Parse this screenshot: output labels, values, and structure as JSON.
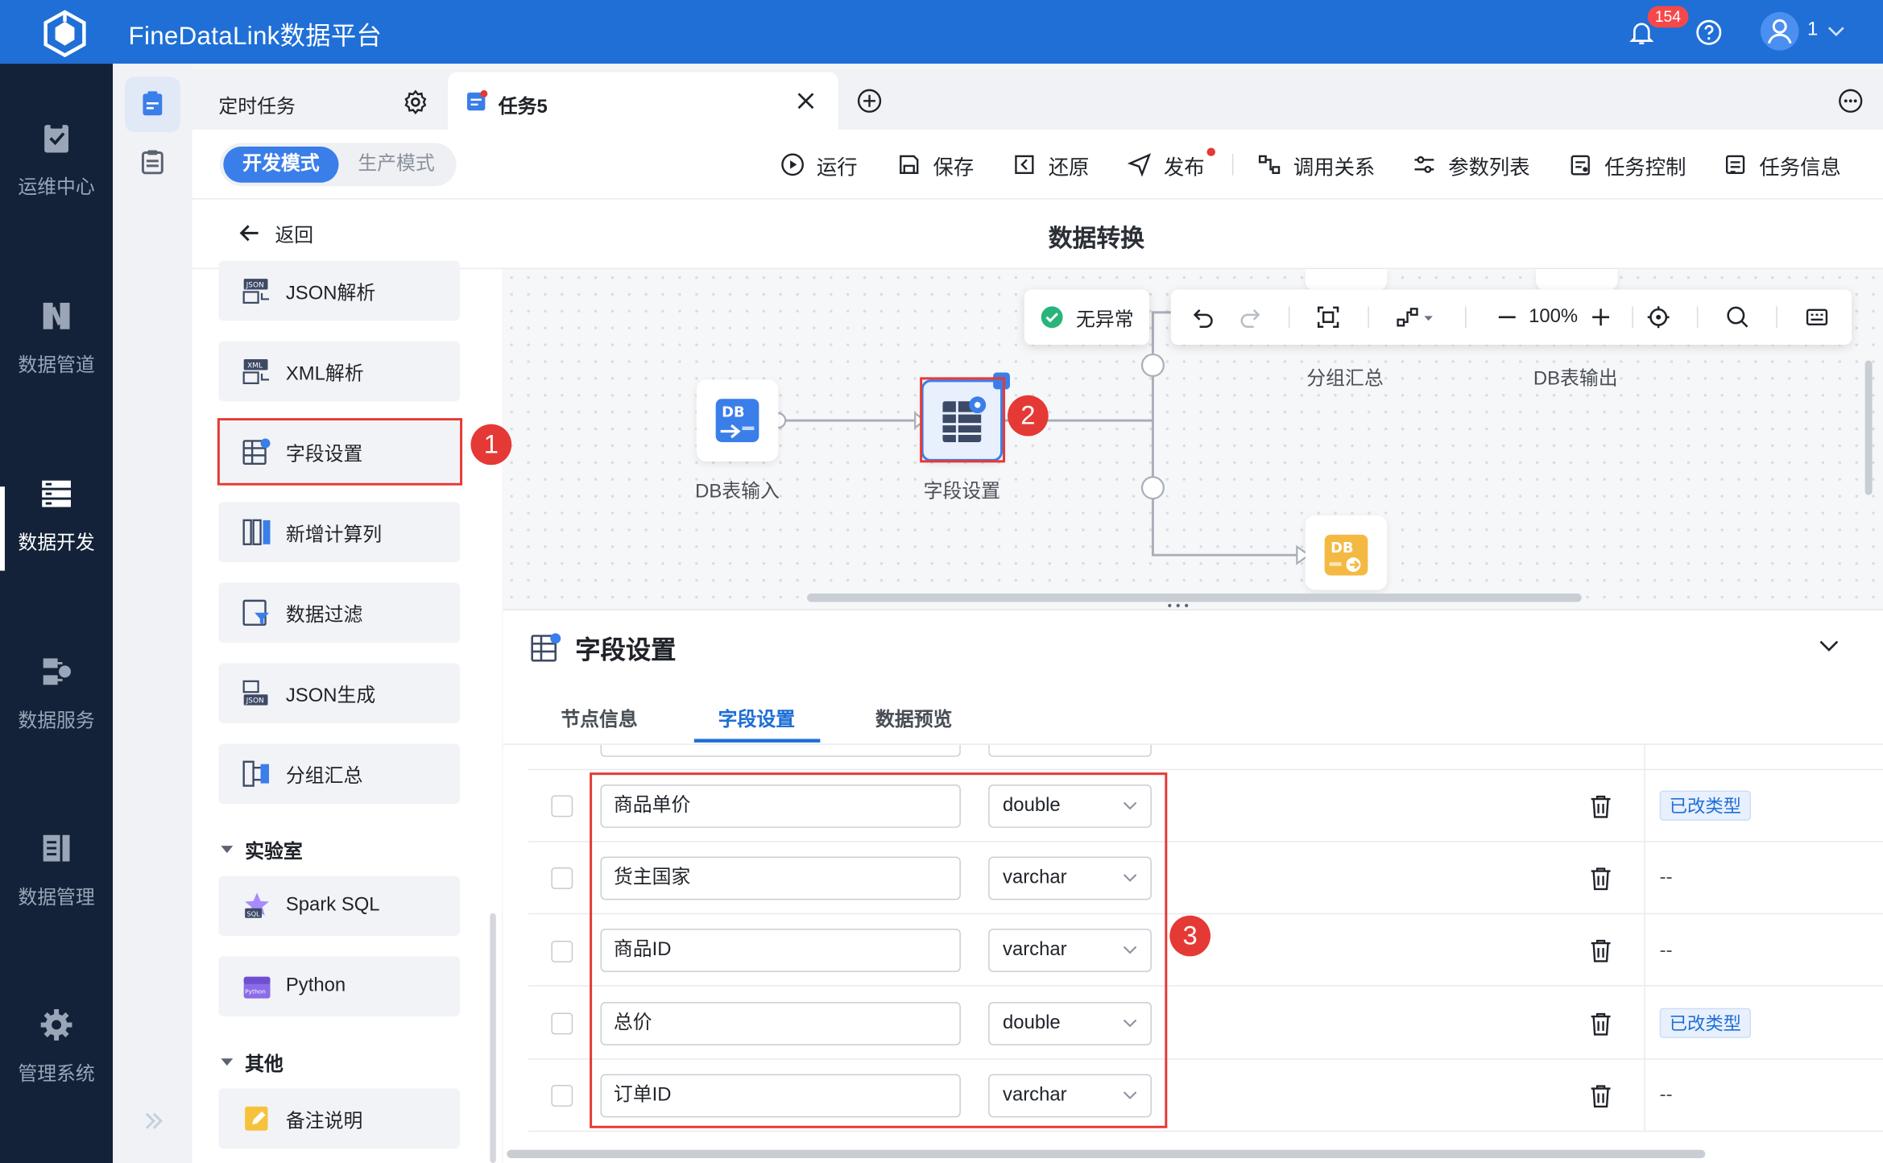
{
  "app": {
    "title": "FineDataLink数据平台",
    "notification_count": "154",
    "user": "1"
  },
  "leftnav": {
    "items": [
      {
        "label": "运维中心"
      },
      {
        "label": "数据管道"
      },
      {
        "label": "数据开发"
      },
      {
        "label": "数据服务"
      },
      {
        "label": "数据管理"
      },
      {
        "label": "管理系统"
      }
    ],
    "active": "数据开发"
  },
  "tabs": [
    {
      "label": "定时任务"
    },
    {
      "label": "任务5"
    }
  ],
  "toolbar": {
    "mode_dev": "开发模式",
    "mode_prod": "生产模式",
    "run": "运行",
    "save": "保存",
    "restore": "还原",
    "publish": "发布",
    "call_relation": "调用关系",
    "param_list": "参数列表",
    "task_control": "任务控制",
    "task_info": "任务信息"
  },
  "titlebar": {
    "back": "返回",
    "title": "数据转换"
  },
  "operators": {
    "items": [
      "JSON解析",
      "XML解析",
      "字段设置",
      "新增计算列",
      "数据过滤",
      "JSON生成",
      "分组汇总"
    ],
    "lab_section": "实验室",
    "lab_items": [
      "Spark SQL",
      "Python"
    ],
    "other_section": "其他",
    "other_items": [
      "备注说明"
    ]
  },
  "canvas": {
    "status": "无异常",
    "zoom": "100%",
    "nodes": [
      "DB表输入",
      "字段设置",
      "分组汇总",
      "DB表输出"
    ],
    "node_badge_db": "DB"
  },
  "panel": {
    "title": "字段设置",
    "tabs": [
      "节点信息",
      "字段设置",
      "数据预览"
    ],
    "active_tab": "字段设置",
    "rows": [
      {
        "name": "商品单价",
        "type": "double",
        "status": "已改类型"
      },
      {
        "name": "货主国家",
        "type": "varchar",
        "status": "--"
      },
      {
        "name": "商品ID",
        "type": "varchar",
        "status": "--"
      },
      {
        "name": "总价",
        "type": "double",
        "status": "已改类型"
      },
      {
        "name": "订单ID",
        "type": "varchar",
        "status": "--"
      }
    ]
  },
  "annotations": [
    "1",
    "2",
    "3"
  ],
  "colors": {
    "primary": "#1f6fd6",
    "nav_bg": "#132238",
    "annotation": "#e53935"
  }
}
